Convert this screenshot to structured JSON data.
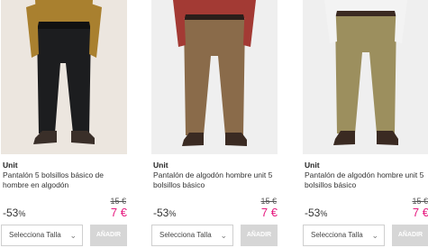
{
  "products": [
    {
      "brand": "Unit",
      "name": "Pantalón 5 bolsillos básico de hombre en algodón",
      "old_price": "15 €",
      "discount": "-53",
      "discount_suffix": "%",
      "price": "7 €",
      "size_placeholder": "Selecciona Talla",
      "add_label": "AÑADIR",
      "pants_color": "#1c1d1f",
      "bg_color": "#ece6df",
      "shirt_color": "#a9802f"
    },
    {
      "brand": "Unit",
      "name": "Pantalón de algodón hombre unit 5 bolsillos básico",
      "old_price": "15 €",
      "discount": "-53",
      "discount_suffix": "%",
      "price": "7 €",
      "size_placeholder": "Selecciona Talla",
      "add_label": "AÑADIR",
      "pants_color": "#8a6b4a",
      "bg_color": "#efefef",
      "shirt_color": "#a33a34"
    },
    {
      "brand": "Unit",
      "name": "Pantalón de algodón hombre unit 5 bolsillos básico",
      "old_price": "15 €",
      "discount": "-53",
      "discount_suffix": "%",
      "price": "7 €",
      "size_placeholder": "Selecciona Talla",
      "add_label": "AÑADIR",
      "pants_color": "#9c8f5e",
      "bg_color": "#efefef",
      "shirt_color": "#f3f3f3"
    }
  ],
  "icons": {
    "select_chevron": "chevron-down-icon"
  },
  "colors": {
    "price_accent": "#e6197f",
    "button_disabled": "#d6d6d6"
  }
}
